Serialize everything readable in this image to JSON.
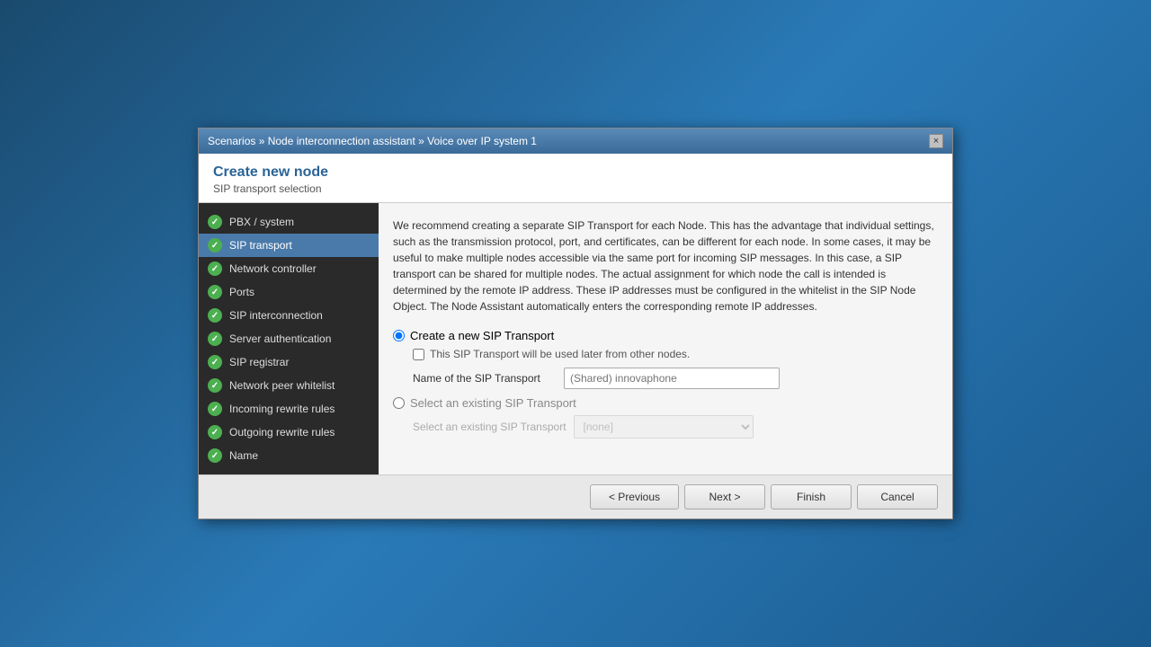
{
  "titlebar": {
    "breadcrumb": "Scenarios » Node interconnection assistant » Voice over IP system 1",
    "close_label": "×"
  },
  "header": {
    "title": "Create new node",
    "subtitle": "SIP transport selection"
  },
  "sidebar": {
    "items": [
      {
        "id": "pbx-system",
        "label": "PBX / system",
        "active": false,
        "checked": true
      },
      {
        "id": "sip-transport",
        "label": "SIP transport",
        "active": true,
        "checked": true
      },
      {
        "id": "network-controller",
        "label": "Network controller",
        "active": false,
        "checked": true
      },
      {
        "id": "ports",
        "label": "Ports",
        "active": false,
        "checked": true
      },
      {
        "id": "sip-interconnection",
        "label": "SIP interconnection",
        "active": false,
        "checked": true
      },
      {
        "id": "server-authentication",
        "label": "Server authentication",
        "active": false,
        "checked": true
      },
      {
        "id": "sip-registrar",
        "label": "SIP registrar",
        "active": false,
        "checked": true
      },
      {
        "id": "network-peer-whitelist",
        "label": "Network peer whitelist",
        "active": false,
        "checked": true
      },
      {
        "id": "incoming-rewrite-rules",
        "label": "Incoming rewrite rules",
        "active": false,
        "checked": true
      },
      {
        "id": "outgoing-rewrite-rules",
        "label": "Outgoing rewrite rules",
        "active": false,
        "checked": true
      },
      {
        "id": "name",
        "label": "Name",
        "active": false,
        "checked": true
      }
    ]
  },
  "content": {
    "info_text": "We recommend creating a separate SIP Transport for each Node. This has the advantage that individual settings, such as the transmission protocol, port, and certificates, can be different for each node. In some cases, it may be useful to make multiple nodes accessible via the same port for incoming SIP messages. In this case, a SIP transport can be shared for multiple nodes. The actual assignment for which node the call is intended is determined by the remote IP address. These IP addresses must be configured in the whitelist in the SIP Node Object. The Node Assistant automatically enters the corresponding remote IP addresses.",
    "radio1_label": "Create a new SIP Transport",
    "checkbox1_label": "This SIP Transport will be used later from other nodes.",
    "name_label": "Name of the SIP Transport",
    "name_placeholder": "(Shared) innovaphone",
    "radio2_label": "Select an existing SIP Transport",
    "existing_label": "Select an existing SIP Transport",
    "existing_value": "[none]"
  },
  "footer": {
    "previous_label": "< Previous",
    "next_label": "Next >",
    "finish_label": "Finish",
    "cancel_label": "Cancel"
  }
}
